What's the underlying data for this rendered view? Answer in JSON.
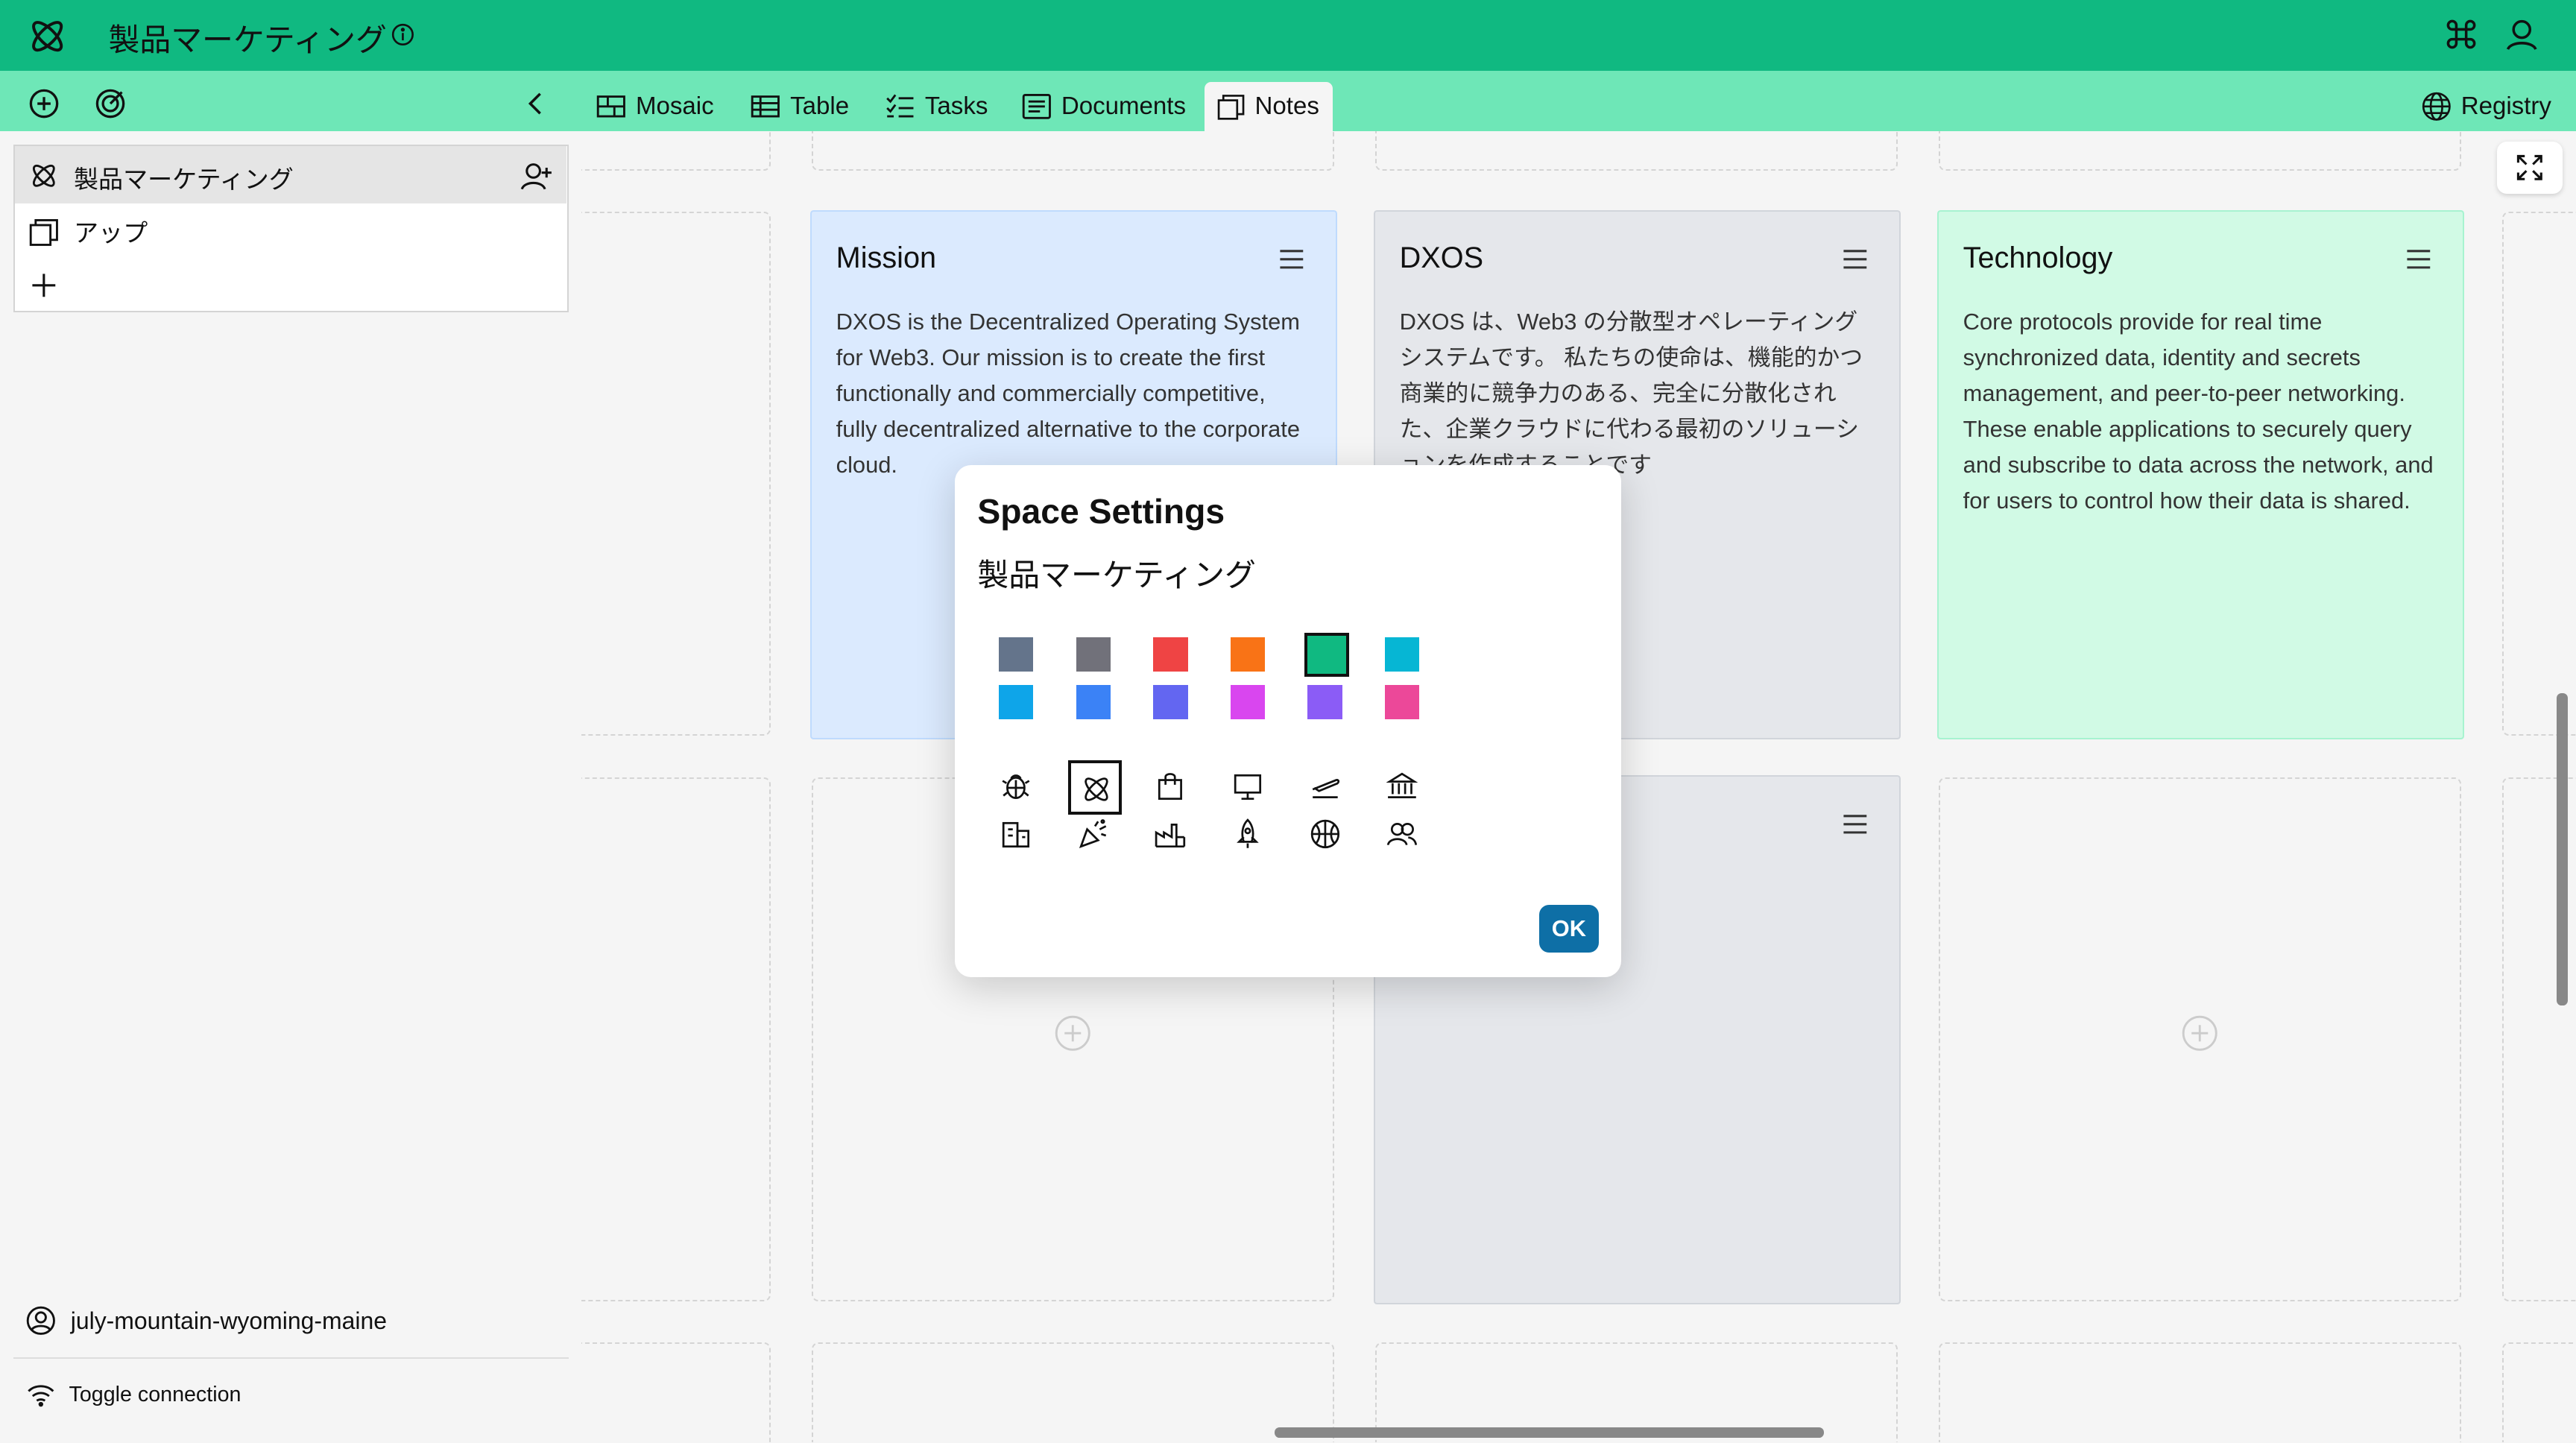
{
  "app": {
    "title": "製品マーケティング",
    "accent": "#10b981",
    "toolbar_bg": "#6ee7b7"
  },
  "toolbar": {
    "tabs": [
      {
        "label": "Mosaic",
        "icon": "grid-icon"
      },
      {
        "label": "Table",
        "icon": "table-icon"
      },
      {
        "label": "Tasks",
        "icon": "checklist-icon"
      },
      {
        "label": "Documents",
        "icon": "document-icon"
      },
      {
        "label": "Notes",
        "icon": "notes-icon",
        "active": true
      }
    ],
    "registry_label": "Registry"
  },
  "sidebar": {
    "space_name": "製品マーケティング",
    "items": [
      {
        "label": "アップ",
        "icon": "notes-icon"
      }
    ],
    "identity": "july-mountain-wyoming-maine",
    "toggle_connection": "Toggle connection"
  },
  "cards": [
    {
      "title": "Mission",
      "color": "#dbeafe",
      "body": "DXOS is the Decentralized Operating System for Web3. Our mission is to create the first functionally and commercially competitive, fully decentralized alternative to the corporate cloud."
    },
    {
      "title": "DXOS",
      "color": "#e5e7eb",
      "body": "DXOS は、Web3 の分散型オペレーティングシステムです。 私たちの使命は、機能的かつ商業的に競争力のある、完全に分散化された、企業クラウドに代わる最初のソリューションを作成することです"
    },
    {
      "title": "Technology",
      "color": "#d1fae5",
      "body": "Core protocols provide for real time synchronized data, identity and secrets management, and peer-to-peer networking. These enable applications to securely query and subscribe to data across the network, and for users to control how their data is shared."
    }
  ],
  "dialog": {
    "title": "Space Settings",
    "space_name": "製品マーケティング",
    "colors": [
      "#64748b",
      "#71717a",
      "#ef4444",
      "#f97316",
      "#10b981",
      "#06b6d4",
      "#0ea5e9",
      "#3b82f6",
      "#6366f1",
      "#d946ef",
      "#8b5cf6",
      "#ec4899"
    ],
    "selected_color": "#10b981",
    "icons": [
      "bug-icon",
      "atom-icon",
      "shopping-bag-icon",
      "presentation-icon",
      "airplane-icon",
      "bank-icon",
      "buildings-icon",
      "confetti-icon",
      "factory-icon",
      "rocket-icon",
      "basketball-icon",
      "users-icon"
    ],
    "selected_icon": "atom-icon",
    "ok_label": "OK"
  }
}
